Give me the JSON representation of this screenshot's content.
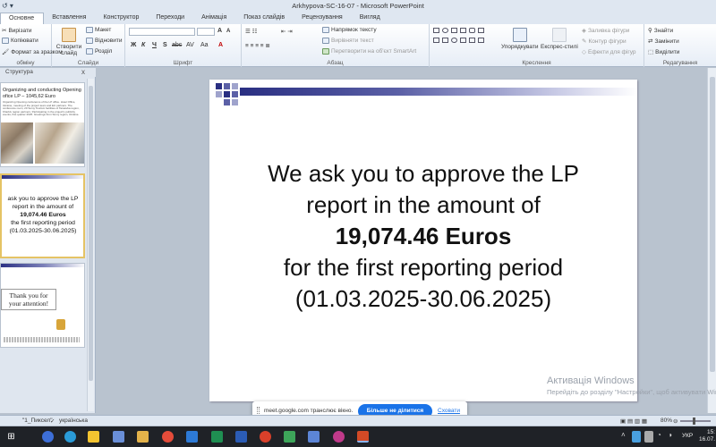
{
  "window": {
    "title": "Arkhypova-SC-16-07  -  Microsoft PowerPoint"
  },
  "tabs": [
    "Основне",
    "Вставлення",
    "Конструктор",
    "Переходи",
    "Анімація",
    "Показ слайдів",
    "Рецензування",
    "Вигляд"
  ],
  "ribbon": {
    "clipboard": {
      "cut": "Вирізати",
      "copy": "Копіювати",
      "format_painter": "Формат за зразком",
      "label": "обміну"
    },
    "slides": {
      "new_slide": "Створити слайд",
      "layout": "Макет",
      "reset": "Відновити",
      "section": "Розділ",
      "label": "Слайди"
    },
    "font": {
      "label": "Шрифт",
      "aa_big": "A",
      "aa_small": "A",
      "bold": "Ж",
      "italic": "К",
      "underline": "Ч",
      "strike": "S",
      "abc": "abc",
      "spacing": "AV",
      "case": "Aa",
      "color": "A"
    },
    "paragraph": {
      "text_direction": "Напрямок тексту",
      "align_text": "Вирівняти текст",
      "smartart": "Перетворити на об'єкт SmartArt",
      "label": "Абзац"
    },
    "drawing": {
      "arrange": "Упорядкувати",
      "quick_styles": "Експрес-стилі",
      "shape_fill": "Заливка фігури",
      "shape_outline": "Контур фігури",
      "shape_effects": "Ефекти для фігур",
      "label": "Креслення"
    },
    "editing": {
      "find": "Знайти",
      "replace": "Замінити",
      "select": "Виділити",
      "label": "Редагування"
    }
  },
  "left_panel": {
    "tab_outline": "Структура",
    "close": "x",
    "thumb1": {
      "title": "Organizing and conducting Opening\nofice LP – 1045,62 Euro",
      "body": "Organizing Opening conference of the LP office. Hotel Office, Ukraine, meeting of the project team and EU partners. The conference room, 20 Sumy Tourism facilities of Tarasivka region, Kharkiv region partners. Participating in the project's publicity events, first quarter 2025. Greetings from Sumy region, Ukraine."
    },
    "thumb2": {
      "lines": [
        "ask you to approve the LP",
        "report in the amount of",
        "19,074.46 Euros",
        "the first reporting period",
        "(01.03.2025-30.06.2025)"
      ]
    },
    "thumb3": {
      "line1": "Thank you for",
      "line2": "your attention!"
    }
  },
  "slide": {
    "line1": "We ask you to approve the LP",
    "line2": "report in the amount of",
    "line3": "19,074.46 Euros",
    "line4": "for the first reporting period",
    "line5": "(01.03.2025-30.06.2025)"
  },
  "watermark": {
    "title": "Активація Windows",
    "subtitle": "Перейдіть до розділу \"Настройки\", щоб активувати Windows."
  },
  "sharebar": {
    "message": "meet.google.com транслює вікно.",
    "stop_label": "Більше не ділитися",
    "hide_label": "Сховати"
  },
  "statusbar": {
    "theme": "\"1_Пиксел\"",
    "language": "українська",
    "zoom": "80%"
  },
  "taskbar": {
    "lang": "УКР",
    "time": "15:",
    "date": "16.07."
  }
}
